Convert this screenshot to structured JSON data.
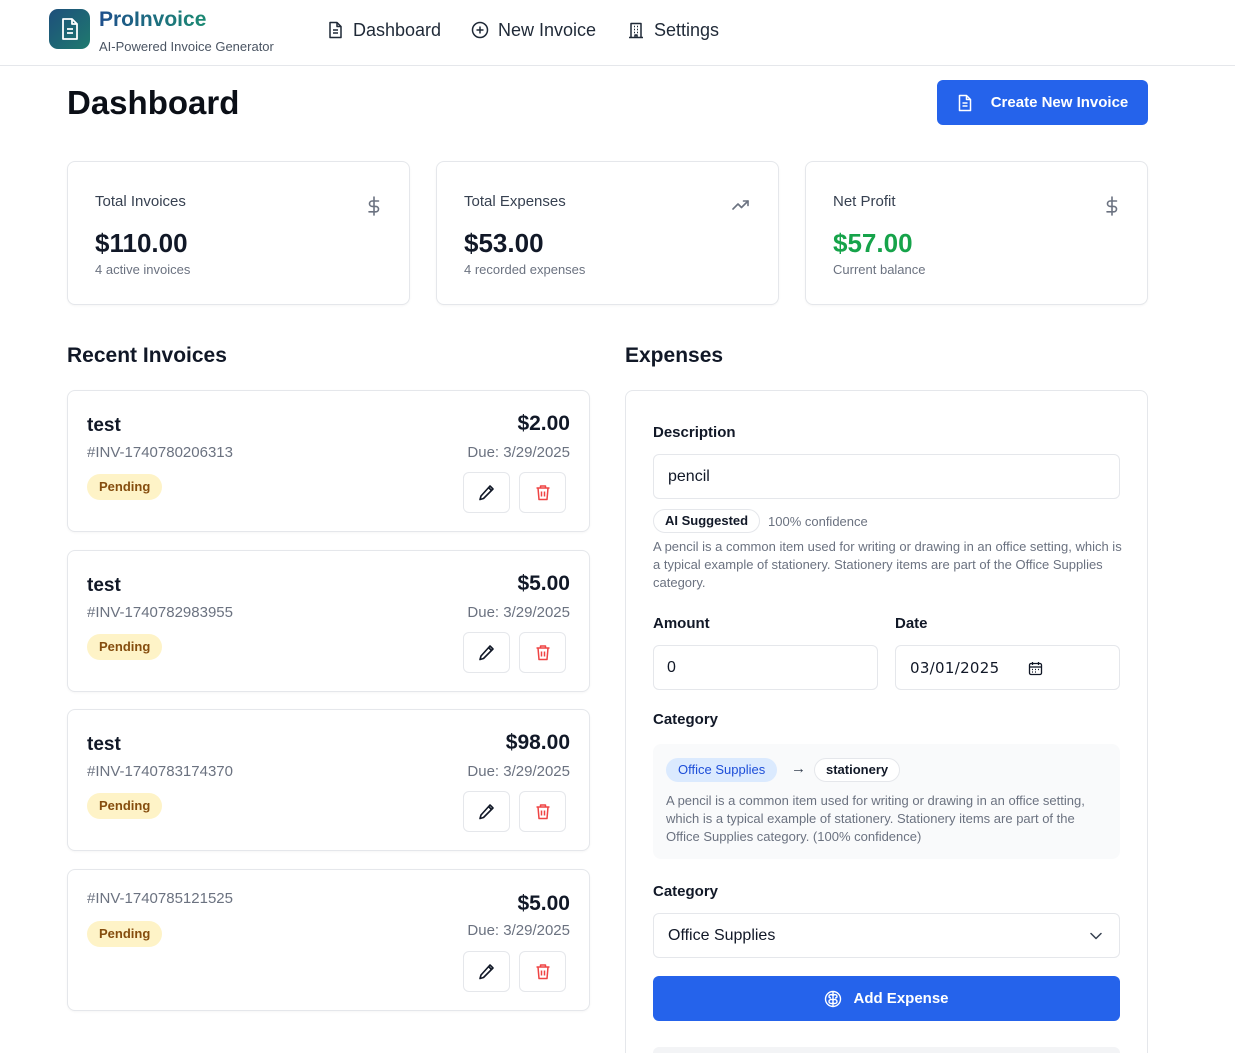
{
  "app": {
    "name": "ProInvoice",
    "tagline": "AI-Powered Invoice Generator"
  },
  "nav": [
    {
      "label": "Dashboard",
      "icon": "file-text-icon"
    },
    {
      "label": "New Invoice",
      "icon": "plus-circle-icon"
    },
    {
      "label": "Settings",
      "icon": "building-icon"
    }
  ],
  "page": {
    "title": "Dashboard",
    "create_button": "Create New Invoice"
  },
  "stats": [
    {
      "label": "Total Invoices",
      "value": "$110.00",
      "sub": "4 active invoices",
      "icon": "dollar-icon"
    },
    {
      "label": "Total Expenses",
      "value": "$53.00",
      "sub": "4 recorded expenses",
      "icon": "trending-up-icon"
    },
    {
      "label": "Net Profit",
      "value": "$57.00",
      "sub": "Current balance",
      "icon": "dollar-icon",
      "value_color": "#16a34a"
    }
  ],
  "recent_invoices": {
    "title": "Recent Invoices",
    "items": [
      {
        "name": "test",
        "number": "#INV-1740780206313",
        "status": "Pending",
        "amount": "$2.00",
        "due": "Due: 3/29/2025"
      },
      {
        "name": "test",
        "number": "#INV-1740782983955",
        "status": "Pending",
        "amount": "$5.00",
        "due": "Due: 3/29/2025"
      },
      {
        "name": "test",
        "number": "#INV-1740783174370",
        "status": "Pending",
        "amount": "$98.00",
        "due": "Due: 3/29/2025"
      },
      {
        "name": "",
        "number": "#INV-1740785121525",
        "status": "Pending",
        "amount": "$5.00",
        "due": "Due: 3/29/2025"
      }
    ]
  },
  "expenses": {
    "title": "Expenses",
    "description_label": "Description",
    "description_value": "pencil",
    "ai_chip": "AI Suggested",
    "confidence": "100% confidence",
    "ai_explanation": "A pencil is a common item used for writing or drawing in an office setting, which is a typical example of stationery. Stationery items are part of the Office Supplies category.",
    "amount_label": "Amount",
    "amount_value": "0",
    "date_label": "Date",
    "date_value": "03/01/2025",
    "category_label": "Category",
    "category_chip": "Office Supplies",
    "arrow": "→",
    "subcategory_chip": "stationery",
    "category_explanation": "A pencil is a common item used for writing or drawing in an office setting, which is a typical example of stationery. Stationery items are part of the Office Supplies category. (100% confidence)",
    "category_select_label": "Category",
    "category_select_value": "Office Supplies",
    "add_button": "Add Expense"
  },
  "colors": {
    "primary": "#2563eb",
    "profit": "#16a34a",
    "pending_bg": "#fef3c7",
    "danger": "#ef4444"
  }
}
